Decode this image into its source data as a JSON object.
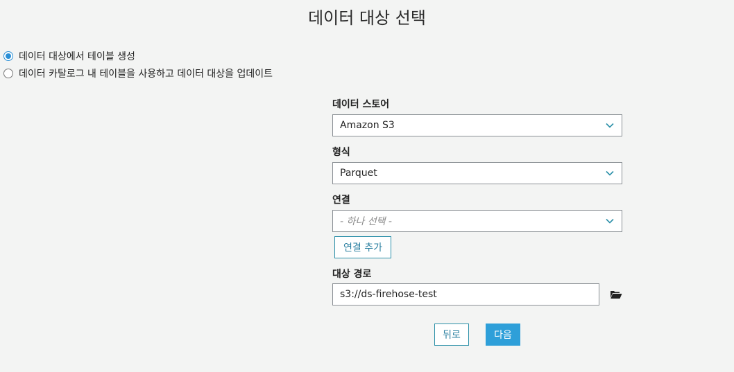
{
  "page": {
    "title": "데이터 대상 선택"
  },
  "options": [
    {
      "label": "데이터 대상에서 테이블 생성",
      "selected": true
    },
    {
      "label": "데이터 카탈로그 내 테이블을 사용하고 데이터 대상을 업데이트",
      "selected": false
    }
  ],
  "form": {
    "data_store": {
      "label": "데이터 스토어",
      "value": "Amazon S3"
    },
    "format": {
      "label": "형식",
      "value": "Parquet"
    },
    "connection": {
      "label": "연결",
      "placeholder": "- 하나 선택 -",
      "add_button": "연결 추가"
    },
    "target_path": {
      "label": "대상 경로",
      "value": "s3://ds-firehose-test",
      "icon": "folder-open-icon"
    }
  },
  "buttons": {
    "back": "뒤로",
    "next": "다음"
  },
  "colors": {
    "accent": "#2e9fd9",
    "background": "#f3f4f3",
    "radio_checked": "#2a8fd6"
  }
}
